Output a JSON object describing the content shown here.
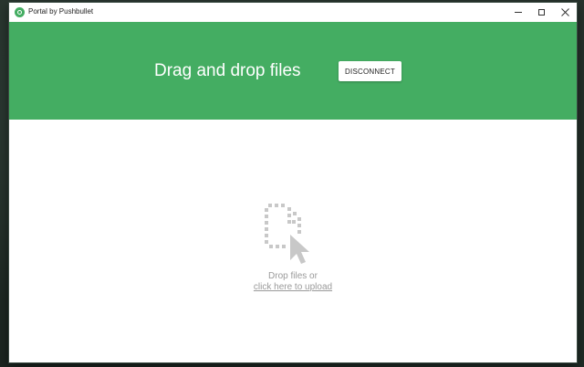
{
  "window": {
    "title": "Portal by Pushbullet",
    "controls": {
      "minimize": "minimize-icon",
      "maximize": "maximize-icon",
      "close": "close-icon"
    }
  },
  "header": {
    "title": "Drag and drop files",
    "button_label": "DISCONNECT",
    "background_color": "#44ad62"
  },
  "dropzone": {
    "icon": "file-drop-icon",
    "line1": "Drop files or",
    "link": "click here to upload",
    "text_color": "#9a9a9a"
  }
}
